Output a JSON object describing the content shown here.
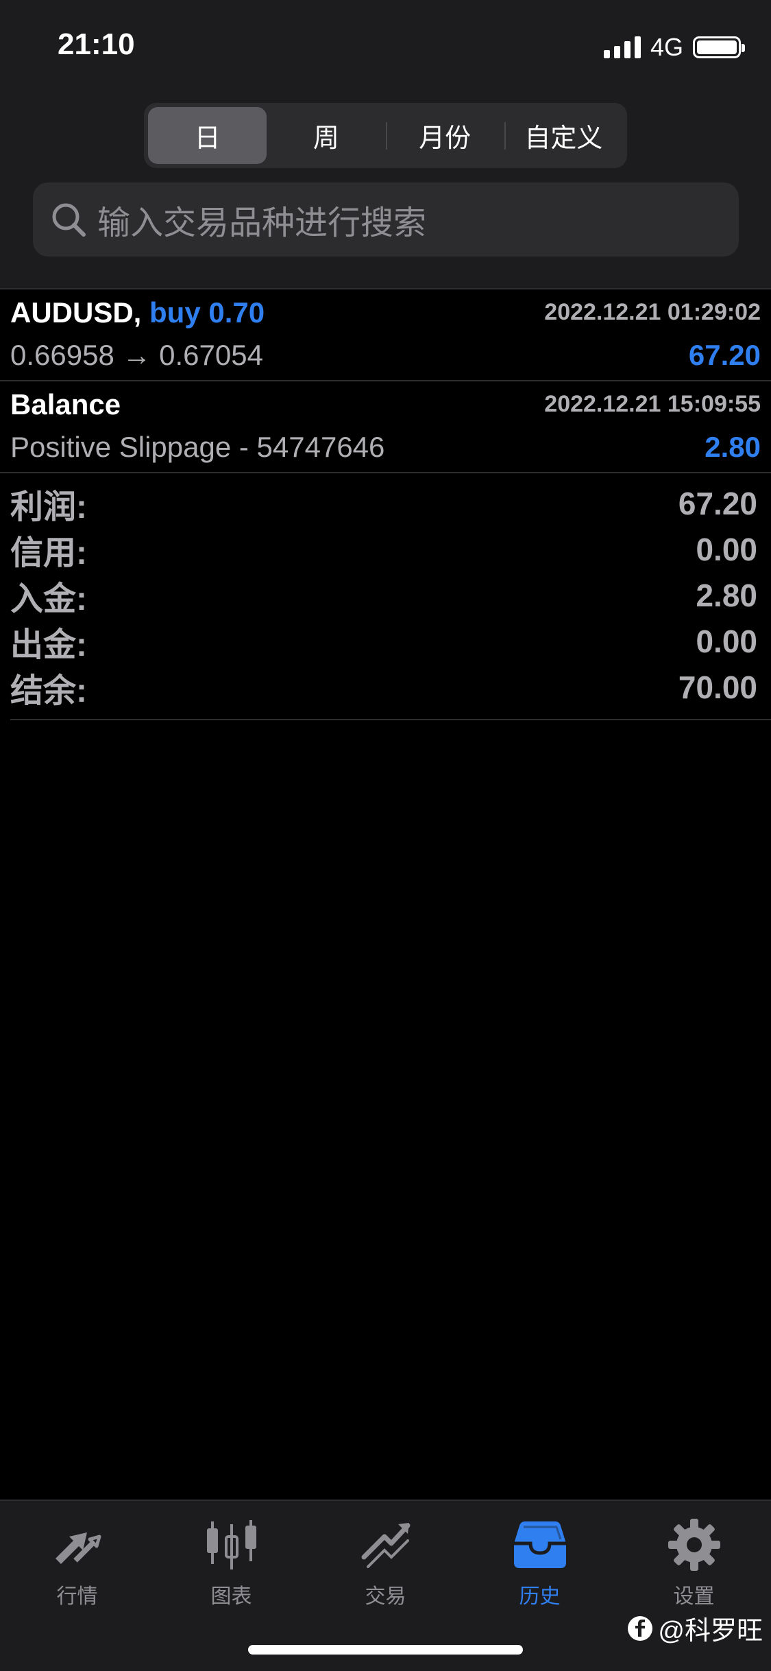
{
  "status_bar": {
    "time": "21:10",
    "network": "4G"
  },
  "period_tabs": [
    {
      "label": "日",
      "active": true
    },
    {
      "label": "周",
      "active": false
    },
    {
      "label": "月份",
      "active": false
    },
    {
      "label": "自定义",
      "active": false
    }
  ],
  "search": {
    "placeholder": "输入交易品种进行搜索",
    "icon": "search-icon"
  },
  "deals": [
    {
      "symbol": "AUDUSD,",
      "side": "buy 0.70",
      "datetime": "2022.12.21 01:29:02",
      "prices": "0.66958 → 0.67054",
      "profit": "67.20"
    },
    {
      "symbol": "Balance",
      "side": "",
      "datetime": "2022.12.21 15:09:55",
      "prices": "Positive Slippage - 54747646",
      "profit": "2.80"
    }
  ],
  "summary": [
    {
      "label": "利润:",
      "value": "67.20"
    },
    {
      "label": "信用:",
      "value": "0.00"
    },
    {
      "label": "入金:",
      "value": "2.80"
    },
    {
      "label": "出金:",
      "value": "0.00"
    },
    {
      "label": "结余:",
      "value": "70.00"
    }
  ],
  "tabbar": [
    {
      "label": "行情",
      "icon": "quotes-icon",
      "active": false
    },
    {
      "label": "图表",
      "icon": "chart-candles-icon",
      "active": false
    },
    {
      "label": "交易",
      "icon": "trade-icon",
      "active": false
    },
    {
      "label": "历史",
      "icon": "history-inbox-icon",
      "active": true
    },
    {
      "label": "设置",
      "icon": "gear-icon",
      "active": false
    }
  ],
  "watermark": "@科罗旺",
  "colors": {
    "accent": "#2f7ff0",
    "background": "#000000",
    "panel": "#1c1c1e",
    "muted_text": "#b0b0b4"
  }
}
